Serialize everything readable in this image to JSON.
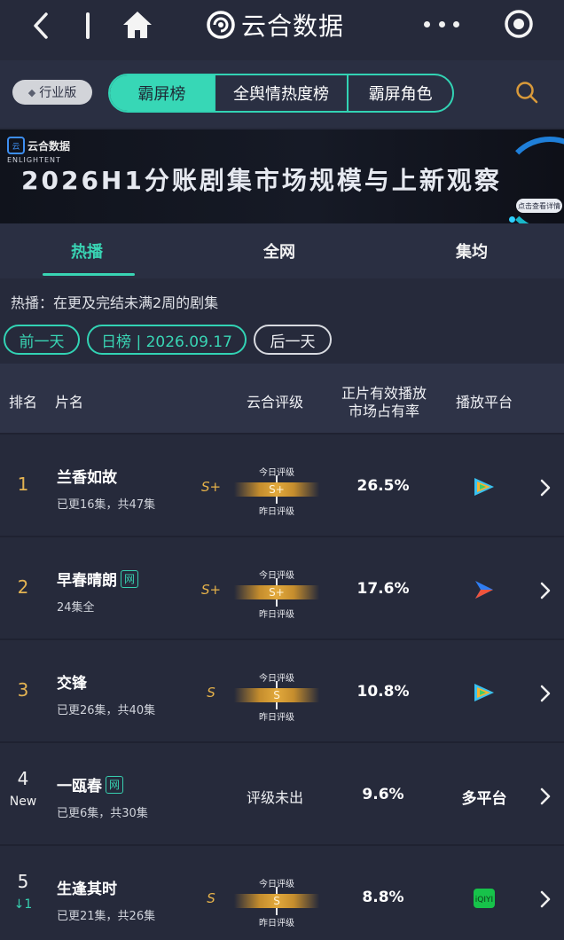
{
  "app": {
    "title": "云合数据"
  },
  "toolbar": {
    "industry_label": "行业版"
  },
  "segments": [
    {
      "label": "霸屏榜",
      "active": true
    },
    {
      "label": "全舆情热度榜",
      "active": false
    },
    {
      "label": "霸屏角色",
      "active": false
    }
  ],
  "banner": {
    "logo_text": "云合数据",
    "logo_sub": "ENLIGHTENT",
    "headline": "2026H1分账剧集市场规模与上新观察",
    "cta": "点击查看详情"
  },
  "subtabs": [
    {
      "label": "热播",
      "active": true
    },
    {
      "label": "全网",
      "active": false
    },
    {
      "label": "集均",
      "active": false
    }
  ],
  "note": "热播：在更及完结未满2周的剧集",
  "date": {
    "prev": "前一天",
    "current": "日榜 | 2026.09.17",
    "next": "后一天"
  },
  "columns": {
    "rank": "排名",
    "name": "片名",
    "grade": "云合评级",
    "share_line1": "正片有效播放",
    "share_line2": "市场占有率",
    "platform": "播放平台"
  },
  "grade_labels": {
    "today": "今日评级",
    "yesterday": "昨日评级",
    "none": "评级未出"
  },
  "rows": [
    {
      "rank": "1",
      "rank_sub": "",
      "title": "兰香如故",
      "tag": "",
      "episodes": "已更16集，共47集",
      "grade": "S+",
      "grade_bar": "S+",
      "share": "26.5%",
      "platform": "tencent",
      "platform_text": "",
      "labels_swapped": false
    },
    {
      "rank": "2",
      "rank_sub": "",
      "title": "早春晴朗",
      "tag": "网",
      "episodes": "24集全",
      "grade": "S+",
      "grade_bar": "S+",
      "share": "17.6%",
      "platform": "youku",
      "platform_text": "",
      "labels_swapped": true
    },
    {
      "rank": "3",
      "rank_sub": "",
      "title": "交锋",
      "tag": "",
      "episodes": "已更26集，共40集",
      "grade": "S",
      "grade_bar": "S",
      "share": "10.8%",
      "platform": "tencent",
      "platform_text": "",
      "labels_swapped": true
    },
    {
      "rank": "4",
      "rank_sub": "New",
      "title": "一瓯春",
      "tag": "网",
      "episodes": "已更6集，共30集",
      "grade": "",
      "grade_bar": "",
      "share": "9.6%",
      "platform": "multi",
      "platform_text": "多平台",
      "labels_swapped": false
    },
    {
      "rank": "5",
      "rank_sub": "↓1",
      "title": "生逢其时",
      "tag": "",
      "episodes": "已更21集，共26集",
      "grade": "S",
      "grade_bar": "S",
      "share": "8.8%",
      "platform": "iqiyi",
      "platform_text": "",
      "labels_swapped": true
    }
  ],
  "colors": {
    "accent": "#37d7b6",
    "gold": "#e3b352",
    "background": "#262a3b"
  }
}
